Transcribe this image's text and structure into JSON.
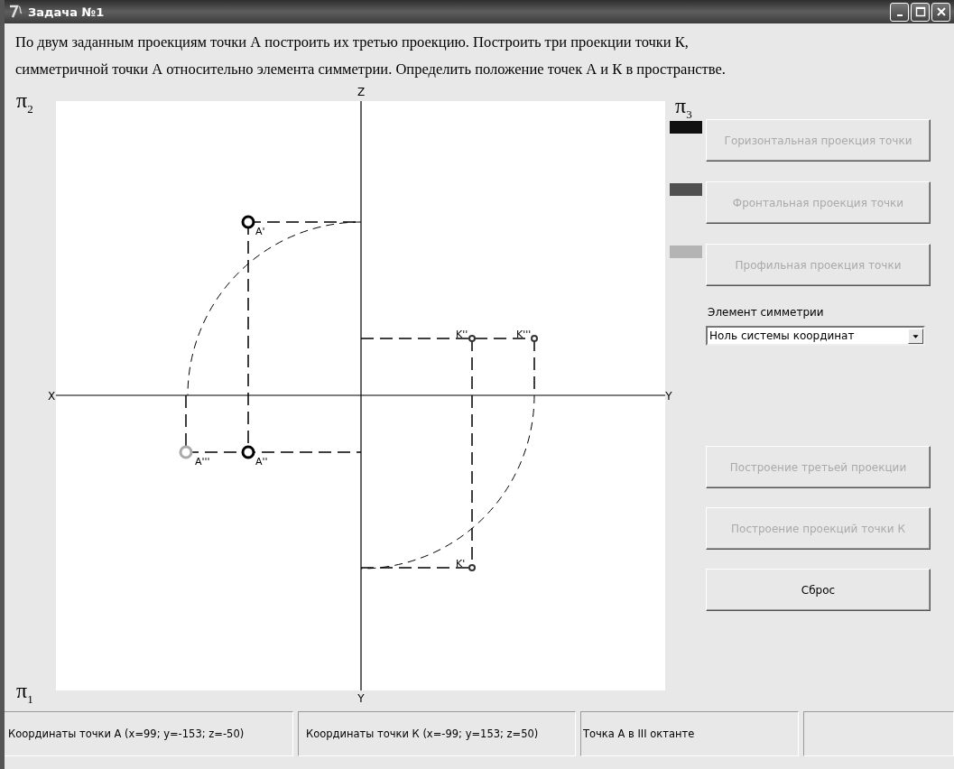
{
  "window": {
    "title": "Задача №1"
  },
  "task_lines": [
    "По двум заданным проекциям точки А построить их третью проекцию. Построить три проекции точки К,",
    "симметричной точки  А относительно элемента симметрии. Определить положение точек А и К в пространстве."
  ],
  "planes": [
    {
      "symbol": "π",
      "index": "2"
    },
    {
      "symbol": "π",
      "index": "1"
    },
    {
      "symbol": "π",
      "index": "3"
    }
  ],
  "axis_labels": [
    "Z",
    "X",
    "Y",
    "Y"
  ],
  "points": [
    {
      "label": "A'",
      "color": "#000000"
    },
    {
      "label": "A''",
      "color": "#000000"
    },
    {
      "label": "A'''",
      "color": "#aaaaaa"
    },
    {
      "label": "K''",
      "color": "#333333"
    },
    {
      "label": "K'''",
      "color": "#333333"
    },
    {
      "label": "K'",
      "color": "#333333"
    }
  ],
  "projection_buttons": [
    {
      "label": "Горизонтальная проекция точки",
      "color": "#111111",
      "disabled": true
    },
    {
      "label": "Фронтальная проекция точки",
      "color": "#505050",
      "disabled": true
    },
    {
      "label": "Профильная проекция точки",
      "color": "#b4b4b4",
      "disabled": true
    }
  ],
  "symmetry": {
    "label": "Элемент симметрии",
    "value": "Ноль системы координат"
  },
  "action_buttons": [
    {
      "label": "Построение третьей проекции",
      "disabled": true
    },
    {
      "label": "Построение проекций точки К",
      "disabled": true
    },
    {
      "label": "Сброс",
      "disabled": false
    }
  ],
  "status_bar": [
    "Координаты точки А (x=99; y=-153; z=-50)",
    "Координаты точки К (x=-99; y=153; z=50)",
    "Точка А в III октанте"
  ]
}
